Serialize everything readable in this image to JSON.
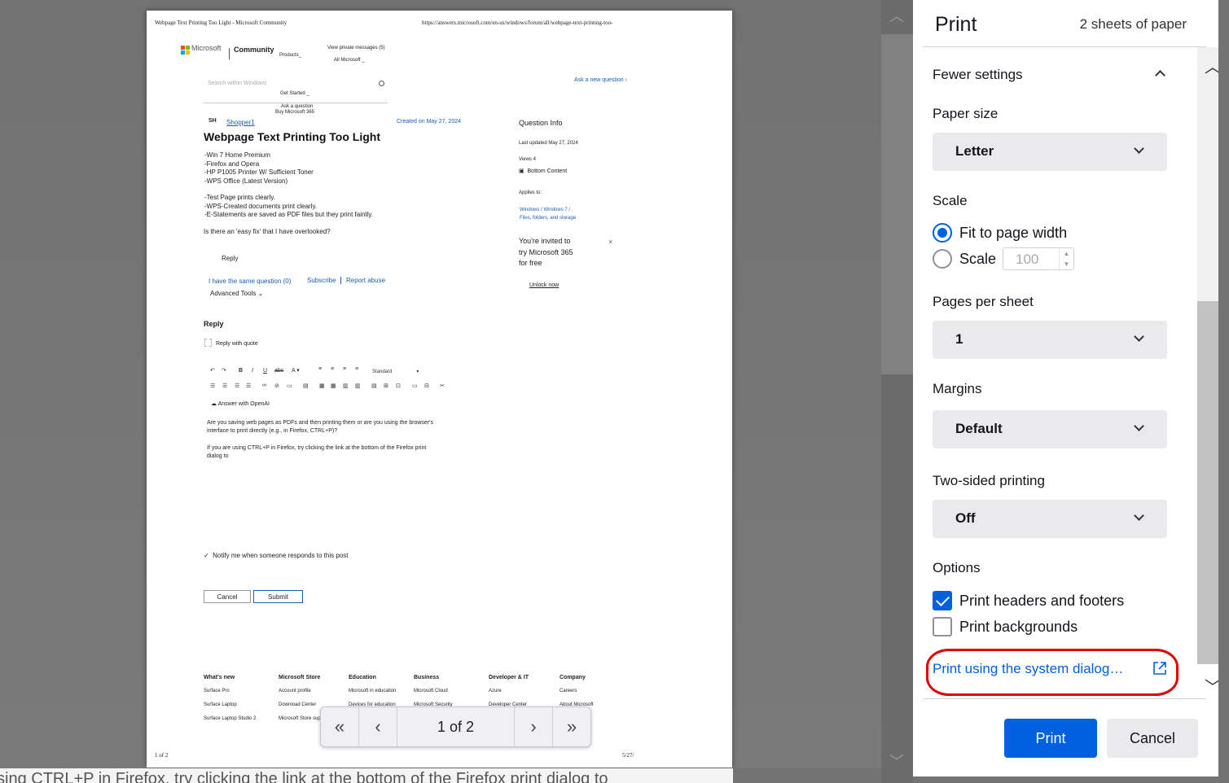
{
  "background": {
    "text": "sing CTRL+P in Firefox, try clicking the link at the bottom of the Firefox print dialog to"
  },
  "paper": {
    "header_title": "Webpage Text Printing Too Light - Microsoft Community",
    "header_url": "https://answers.microsoft.com/en-us/windows/forum/all/webpage-text-printing-too-",
    "brand": "Microsoft",
    "community": "Community",
    "nav_products": "Products_",
    "nav_private_messages": "View private messages (5)",
    "nav_all_microsoft": "All Microsoft _",
    "nav_get_started": "Get Started _",
    "nav_ask": "Ask a question",
    "nav_buy": "Buy Microsoft 365",
    "search_placeholder": "Search within Windows",
    "ask_new": "Ask a new question",
    "avatar": "SH",
    "username": "Shopper1",
    "created": "Created on May 27, 2024",
    "question_title": "Webpage Text Printing Too Light",
    "body_lines": [
      "-Win 7 Home Premium",
      "-Firefox and Opera",
      "-HP P1005 Printer W/ Sufficient Toner",
      "-WPS Office (Latest Version)"
    ],
    "body_lines2": [
      "-Test Page prints clearly.",
      "-WPS-Created documents print clearly.",
      "-E-Statements are saved as PDF files but they print faintly."
    ],
    "body_question": "Is there an 'easy fix' that I have overlooked?",
    "reply_btn": "Reply",
    "same_question": "I have the same question (0)",
    "subscribe": "Subscribe",
    "report": "Report abuse",
    "advanced_tools": "Advanced Tools",
    "question_info": "Question Info",
    "last_updated": "Last updated May 27, 2024",
    "views": "Views 4",
    "bottom_content": "Bottom Content",
    "applies_to": "Applies to:",
    "applies_links": [
      "Windows",
      "Windows 7",
      "Files, folders, and storage"
    ],
    "promo_lines": [
      "You're invited to",
      "try Microsoft 365",
      "for free"
    ],
    "promo_close": "×",
    "unlock": "Unlock now",
    "reply_heading": "Reply",
    "reply_quote": "Reply with quote",
    "editor_style": "Standard",
    "answer_openai": "Answer with OpenAI",
    "answer_lines": [
      "Are you saving web pages as PDFs and then printing them or are you using the browser's",
      "interface to print directly (e.g., in Firefox, CTRL+P)?"
    ],
    "answer_lines2": [
      "If you are using CTRL+P in Firefox, try clicking the link at the bottom of the Firefox print",
      "dialog to"
    ],
    "notify": "Notify me when someone responds to this post",
    "cancel": "Cancel",
    "submit": "Submit",
    "footer_cols": [
      {
        "head": "What's new",
        "items": [
          "Surface Pro",
          "Surface Laptop",
          "Surface Laptop Studio 2"
        ]
      },
      {
        "head": "Microsoft Store",
        "items": [
          "Account profile",
          "Download Center",
          "Microsoft Store sup"
        ]
      },
      {
        "head": "Education",
        "items": [
          "Microsoft in education",
          "Devices for education"
        ]
      },
      {
        "head": "Business",
        "items": [
          "Microsoft Cloud",
          "Microsoft Security"
        ]
      },
      {
        "head": "Developer & IT",
        "items": [
          "Azure",
          "Developer Center"
        ]
      },
      {
        "head": "Company",
        "items": [
          "Careers",
          "About Microsoft"
        ]
      }
    ],
    "page_footer_left": "1 of 2",
    "page_footer_right": "5/27/"
  },
  "pagenav": {
    "first": "«",
    "prev": "‹",
    "page": "1 of 2",
    "next": "›",
    "last": "»"
  },
  "panel": {
    "title": "Print",
    "sheets": "2 sheets of paper",
    "fewer_settings": "Fewer settings",
    "paper_size_label": "Paper size",
    "paper_size_value": "Letter",
    "scale_label": "Scale",
    "fit_width": "Fit to page width",
    "scale_option": "Scale",
    "scale_value": "100",
    "pages_per_sheet_label": "Pages per sheet",
    "pages_per_sheet_value": "1",
    "margins_label": "Margins",
    "margins_value": "Default",
    "two_sided_label": "Two-sided printing",
    "two_sided_value": "Off",
    "options_label": "Options",
    "headers_footers": "Print headers and footers",
    "headers_footers_checked": true,
    "backgrounds": "Print backgrounds",
    "backgrounds_checked": false,
    "system_dialog": "Print using the system dialog…",
    "print_btn": "Print",
    "cancel_btn": "Cancel"
  },
  "colors": {
    "accent": "#0061e0",
    "highlight": "#e30000",
    "link": "#1a5fb4"
  }
}
